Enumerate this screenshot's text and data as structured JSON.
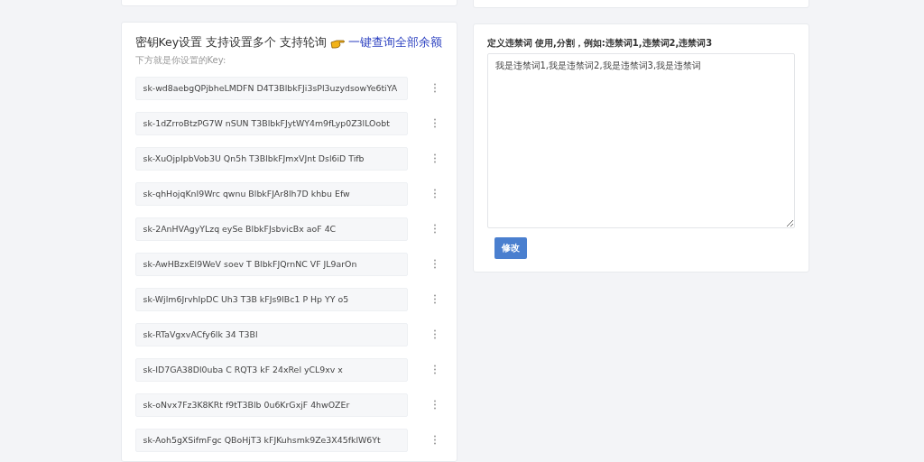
{
  "keys_card": {
    "title": "密钥Key设置 支持设置多个 支持轮询",
    "link": "一键查询全部余额",
    "subtitle": "下方就是你设置的Key:",
    "keys": [
      "sk-wd8aebgQPjbheLMDFN D4T3BlbkFJi3sPl3uzydsowYe6tiYA",
      "sk-1dZrroBtzPG7W nSUN T3BlbkFJytWY4m9fLyp0Z3lLOobt",
      "sk-XuOjpIpbVob3U Qn5h T3BlbkFJmxVJnt Dsl6iD Tifb",
      "sk-qhHojqKnI9Wrc qwnu BlbkFJAr8lh7D khbu Efw",
      "sk-2AnHVAgyYLzq eySe BlbkFJsbvicBx aoF 4C",
      "sk-AwHBzxEl9WeV soev T BlbkFJQrnNC VF JL9arOn",
      "sk-Wjlm6JrvhIpDC Uh3 T3B kFJs9lBc1 P Hp YY o5",
      "sk-RTaVgxvACfy6lk 34 T3Bl",
      "sk-ID7GA38Dl0uba C RQT3 kF 24xRel yCL9xv x",
      "sk-oNvx7Fz3K8KRt f9tT3Blb 0u6KrGxjF 4hwOZEr",
      "sk-Aoh5gXSifmFgc QBoHjT3 kFJKuhsmk9Ze3X45fklW6Yt"
    ]
  },
  "words_card": {
    "label": "定义违禁词 使用,分割，例如:违禁词1,违禁词2,违禁词3",
    "value": "我是违禁词1,我是违禁词2,我是违禁词3,我是违禁词",
    "button": "修改"
  }
}
